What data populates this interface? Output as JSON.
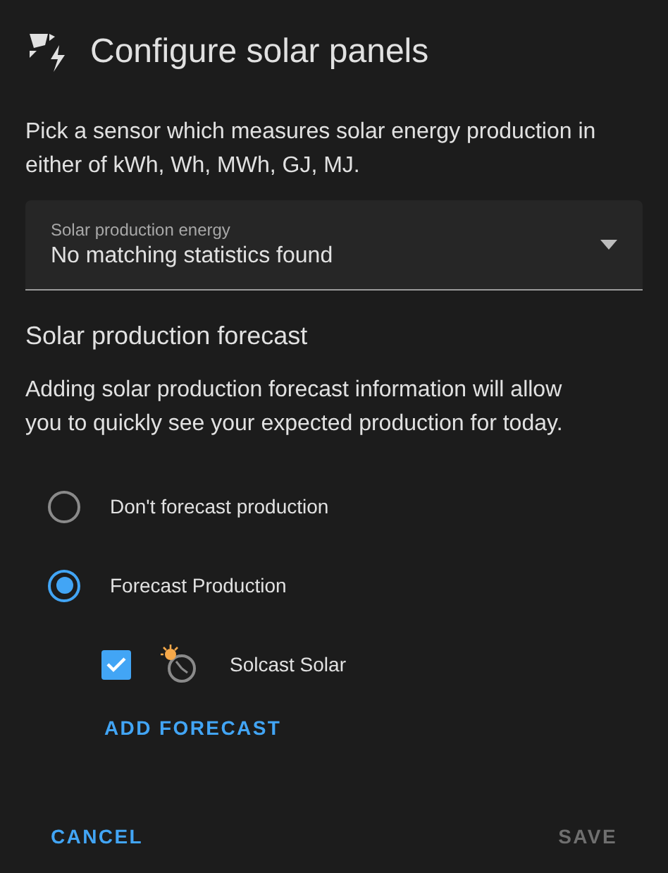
{
  "dialog": {
    "title": "Configure solar panels"
  },
  "description": "Pick a sensor which measures solar energy production in either of kWh, Wh, MWh, GJ, MJ.",
  "select": {
    "label": "Solar production energy",
    "value": "No matching statistics found"
  },
  "forecast": {
    "heading": "Solar production forecast",
    "description": "Adding solar production forecast information will allow you to quickly see your expected production for today.",
    "options": [
      {
        "label": "Don't forecast production",
        "selected": false
      },
      {
        "label": "Forecast Production",
        "selected": true
      }
    ],
    "integrations": [
      {
        "name": "Solcast Solar",
        "checked": true
      }
    ],
    "add_button": "ADD FORECAST"
  },
  "actions": [
    {
      "label": "CANCEL",
      "disabled": false
    },
    {
      "label": "SAVE",
      "disabled": true
    }
  ]
}
